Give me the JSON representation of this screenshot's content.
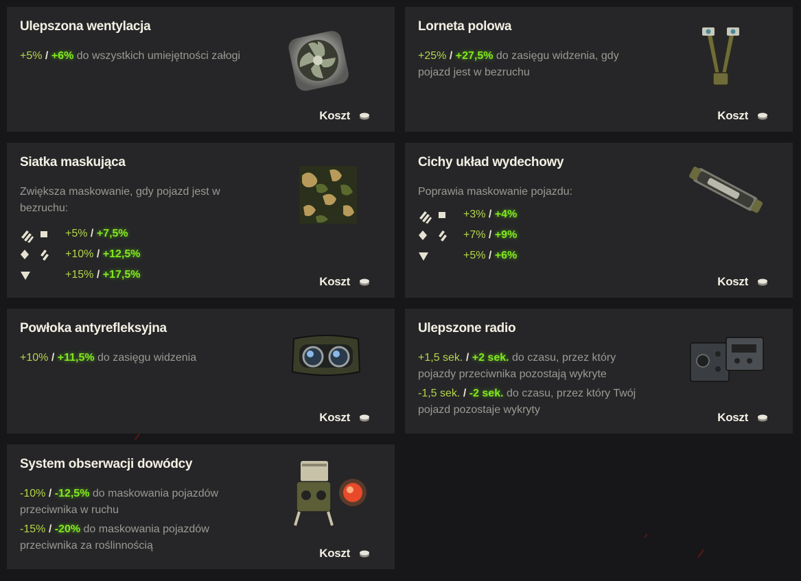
{
  "cost_label": "Koszt",
  "cards": [
    {
      "title": "Ulepszona wentylacja",
      "lines": [
        {
          "low": "+5%",
          "sep": "/",
          "high": "+6%",
          "text": "do wszystkich umiejętności załogi"
        }
      ],
      "icon": "ventilation-fan-icon"
    },
    {
      "title": "Lorneta polowa",
      "lines": [
        {
          "low": "+25%",
          "sep": "/",
          "high": "+27,5%",
          "text": "do zasięgu widzenia, gdy",
          "text2": "pojazd jest w bezruchu"
        }
      ],
      "icon": "binocular-periscope-icon"
    },
    {
      "title": "Siatka maskująca",
      "desc": "Zwiększa maskowanie, gdy pojazd jest w",
      "desc2": "bezruchu:",
      "rows": [
        {
          "icons": "light-tank-icon, square-icon",
          "low": "+5%",
          "sep": "/",
          "high": "+7,5%"
        },
        {
          "icons": "diamond-icon, medium-tank-icon",
          "low": "+10%",
          "sep": "/",
          "high": "+12,5%"
        },
        {
          "icons": "triangle-icon",
          "low": "+15%",
          "sep": "/",
          "high": "+17,5%"
        }
      ],
      "icon": "camouflage-net-icon"
    },
    {
      "title": "Cichy układ wydechowy",
      "desc": "Poprawia maskowanie pojazdu:",
      "rows": [
        {
          "icons": "light-tank-icon, square-icon",
          "low": "+3%",
          "sep": "/",
          "high": "+4%"
        },
        {
          "icons": "diamond-icon, medium-tank-icon",
          "low": "+7%",
          "sep": "/",
          "high": "+9%"
        },
        {
          "icons": "triangle-icon",
          "low": "+5%",
          "sep": "/",
          "high": "+6%"
        }
      ],
      "icon": "exhaust-muffler-icon"
    },
    {
      "title": "Powłoka antyrefleksyjna",
      "lines": [
        {
          "low": "+10%",
          "sep": "/",
          "high": "+11,5%",
          "text": "do zasięgu widzenia"
        }
      ],
      "icon": "optics-goggles-icon"
    },
    {
      "title": "Ulepszone radio",
      "lines": [
        {
          "low": "+1,5 sek.",
          "sep": "/",
          "high": "+2 sek.",
          "text": "do czasu, przez który",
          "text2": "pojazdy przeciwnika pozostają wykryte"
        },
        {
          "low": "-1,5 sek.",
          "sep": "/",
          "high": "-2 sek.",
          "text": "do czasu, przez który Twój",
          "text2": "pojazd pozostaje wykryty"
        }
      ],
      "icon": "radio-set-icon"
    },
    {
      "title": "System obserwacji dowódcy",
      "lines": [
        {
          "low": "-10%",
          "sep": "/",
          "high": "-12,5%",
          "text": "do maskowania pojazdów",
          "text2": "przeciwnika w ruchu"
        },
        {
          "low": "-15%",
          "sep": "/",
          "high": "-20%",
          "text": "do maskowania pojazdów",
          "text2": "przeciwnika za roślinnością"
        }
      ],
      "icon": "commander-vision-system-icon"
    }
  ],
  "colors": {
    "bg": "#17171a",
    "card": "#262628",
    "light_green": "#b4d64a",
    "bright_green": "#7fe81e",
    "title": "#f3f0e4",
    "desc": "#9a9a94"
  }
}
